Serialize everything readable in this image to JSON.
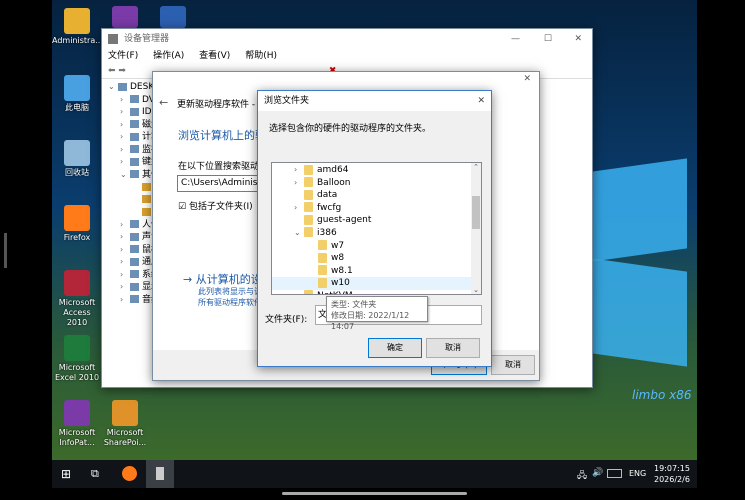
{
  "desktop": {
    "icons": [
      {
        "label": "Administra...",
        "color": "#e8b030"
      },
      {
        "label": "此电脑",
        "color": "#49a0e0"
      },
      {
        "label": "回收站",
        "color": "#8fb8d8"
      },
      {
        "label": "Firefox",
        "color": "#ff7a18"
      },
      {
        "label": "Microsoft Access 2010",
        "color": "#b3263a"
      },
      {
        "label": "Microsoft Excel 2010",
        "color": "#1e7b3c"
      },
      {
        "label": "Microsoft InfoPat...",
        "color": "#7a3aa8"
      },
      {
        "label": "Microsoft SharePoi...",
        "color": "#e0922a"
      }
    ],
    "top_icons": [
      {
        "name": "infopath",
        "color": "#7a3aa8"
      },
      {
        "name": "word",
        "color": "#2b5fb0"
      }
    ],
    "watermark": "limbo x86"
  },
  "device_manager": {
    "title": "设备管理器",
    "menu": [
      "文件(F)",
      "操作(A)",
      "查看(V)",
      "帮助(H)"
    ],
    "tree": [
      "DESKT",
      "DVI",
      "IDE",
      "磁盘",
      "计算",
      "监视",
      "键盘",
      "其他",
      "",
      "",
      "",
      "人体",
      "声音",
      "鼠标",
      "通用",
      "系统",
      "显示",
      "音频"
    ]
  },
  "update_driver": {
    "title": "更新驱动程序软件 -",
    "heading": "浏览计算机上的驱",
    "search_label": "在以下位置搜索驱动程序",
    "path_value": "C:\\Users\\Administrat",
    "include_subfolders": "包括子文件夹(I)",
    "include_checked": true,
    "pick_link": "→ 从计算机的设",
    "pick_desc1": "此列表将显示与该",
    "pick_desc2": "所有驱动程序软件",
    "next_button": "下一步(N)",
    "cancel_button": "取消"
  },
  "browse": {
    "title": "浏览文件夹",
    "instruction": "选择包含你的硬件的驱动程序的文件夹。",
    "folders": [
      {
        "name": "amd64",
        "expand": "closed",
        "level": 0
      },
      {
        "name": "Balloon",
        "expand": "closed",
        "level": 0
      },
      {
        "name": "data",
        "expand": "none",
        "level": 0
      },
      {
        "name": "fwcfg",
        "expand": "closed",
        "level": 0
      },
      {
        "name": "guest-agent",
        "expand": "none",
        "level": 0
      },
      {
        "name": "i386",
        "expand": "open",
        "level": 0
      },
      {
        "name": "w7",
        "expand": "none",
        "level": 1
      },
      {
        "name": "w8",
        "expand": "none",
        "level": 1
      },
      {
        "name": "w8.1",
        "expand": "none",
        "level": 1
      },
      {
        "name": "w10",
        "expand": "none",
        "level": 1,
        "hover": true
      },
      {
        "name": "NetKVM",
        "expand": "closed",
        "level": 0
      }
    ],
    "folder_label": "文件夹(F):",
    "folder_value": "文",
    "tooltip_type": "类型: 文件夹",
    "tooltip_date": "修改日期: 2022/1/12 14:07",
    "ok": "确定",
    "cancel": "取消"
  },
  "taskbar": {
    "time": "19:07:15",
    "date": "2026/2/6",
    "lang": "ENG"
  }
}
